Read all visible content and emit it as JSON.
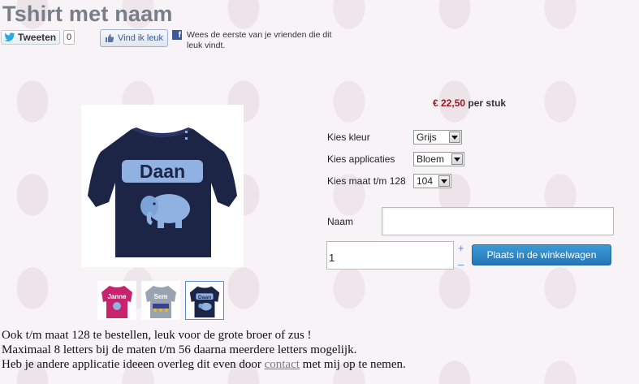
{
  "page": {
    "title": "Tshirt met naam"
  },
  "social": {
    "tweet_label": "Tweeten",
    "tweet_count": "0",
    "like_label": "Vind ik leuk",
    "like_text": "Wees de eerste van je vrienden die dit leuk vindt."
  },
  "product": {
    "price_amount": "€ 22,50",
    "price_unit": "per stuk",
    "main_image_text": "Daan",
    "thumbnails": [
      {
        "text": "Janne",
        "color": "#c8246e"
      },
      {
        "text": "Sem",
        "color": "#9aa3b0"
      },
      {
        "text": "Daan",
        "color": "#1d2547"
      }
    ]
  },
  "options": [
    {
      "label": "Kies kleur",
      "value": "Grijs"
    },
    {
      "label": "Kies applicaties",
      "value": "Bloem"
    },
    {
      "label": "Kies maat t/m 128",
      "value": "104"
    }
  ],
  "form": {
    "naam_label": "Naam",
    "naam_value": "",
    "quantity": "1",
    "increase": "+",
    "decrease": "–",
    "add_to_cart": "Plaats in de winkelwagen"
  },
  "description": {
    "line1": "Ook t/m maat 128 te bestellen, leuk voor de grote broer of zus !",
    "line2": "Maximaal 8 letters bij de maten t/m 56 daarna meerdere letters mogelijk.",
    "line3_before": "Heb je andere applicatie ideeen overleg dit even door",
    "line3_link": "contact",
    "line3_after": "met mij op te nemen."
  },
  "colors": {
    "accent": "#2e85c6",
    "price": "#a01622",
    "title": "#777e88",
    "tee_navy": "#1d2547",
    "applique_blue": "#8fb2e2"
  }
}
